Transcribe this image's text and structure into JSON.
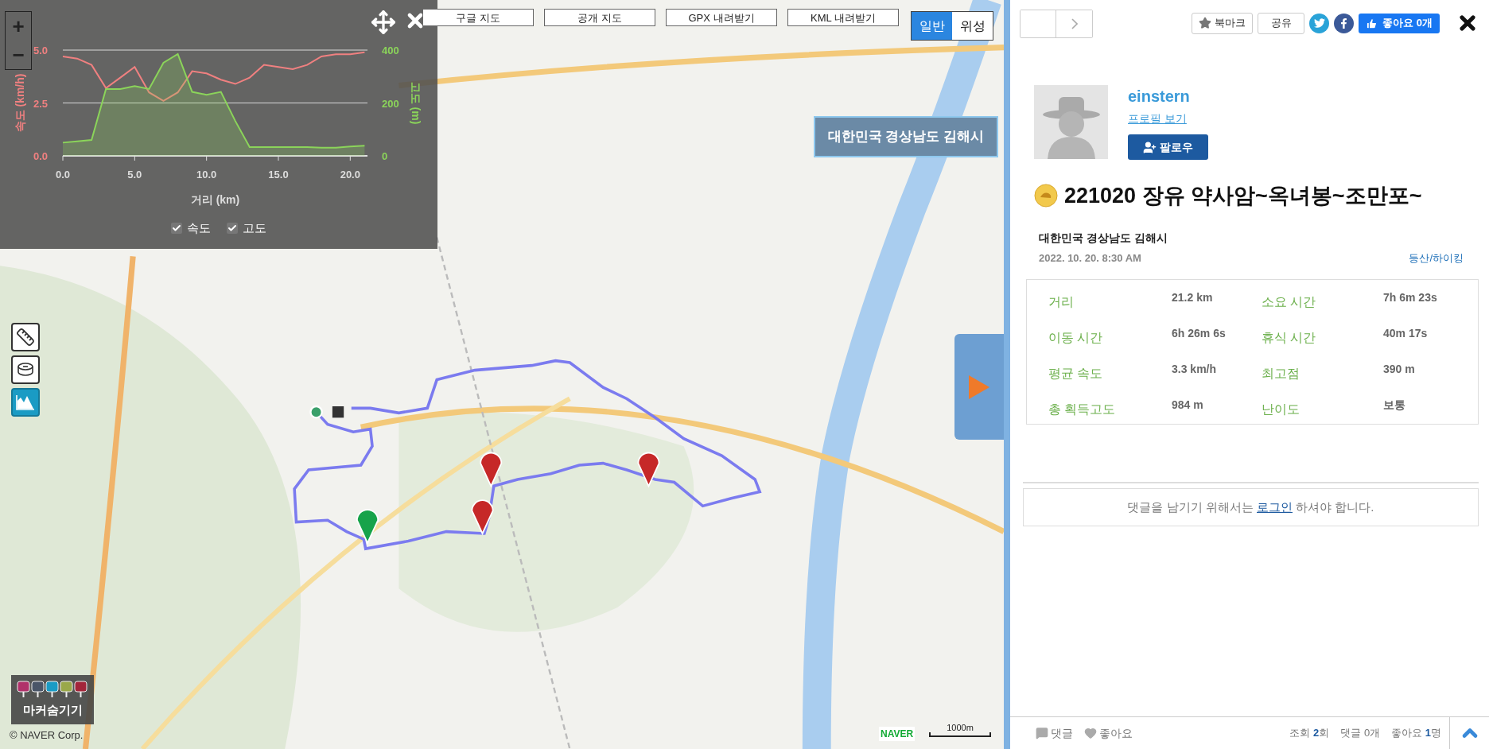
{
  "map": {
    "top_buttons": [
      "구글 지도",
      "공개 지도",
      "GPX 내려받기",
      "KML 내려받기"
    ],
    "map_types": [
      {
        "label": "일반",
        "selected": true
      },
      {
        "label": "위성",
        "selected": false
      }
    ],
    "location_label": "대한민국 경상남도 김해시",
    "tools": [
      {
        "kind": "ruler",
        "selected": false
      },
      {
        "kind": "tape",
        "selected": false
      },
      {
        "kind": "chart",
        "selected": true
      }
    ],
    "marker_toggle": "마커숨기기",
    "attribution": "© NAVER Corp.",
    "logo": "NAVER",
    "scale": "1000m"
  },
  "elevation_panel": {
    "zoom": [
      "+",
      "−"
    ],
    "chart_data": {
      "type": "line",
      "xlabel": "거리 (km)",
      "ylabel": "속도 (km/h)",
      "y2label": "고도 (m)",
      "x": [
        0,
        1,
        2,
        3,
        4,
        5,
        6,
        7,
        8,
        9,
        10,
        11,
        12,
        13,
        14,
        15,
        16,
        17,
        18,
        19,
        20,
        21
      ],
      "xlim": [
        0,
        21.2
      ],
      "ylim": [
        0,
        5
      ],
      "y2lim": [
        0,
        400
      ],
      "xticks": [
        {
          "value": 0,
          "label": "0.0"
        },
        {
          "value": 5,
          "label": "5.0"
        },
        {
          "value": 10,
          "label": "10.0"
        },
        {
          "value": 15,
          "label": "15.0"
        },
        {
          "value": 20,
          "label": "20.0"
        }
      ],
      "yticks": [
        {
          "value": 0,
          "label": "0.0"
        },
        {
          "value": 2.5,
          "label": "2.5"
        },
        {
          "value": 5,
          "label": "5.0"
        }
      ],
      "y2ticks": [
        0,
        200,
        400
      ],
      "series": [
        {
          "name": "속도",
          "color": "#f08080",
          "values": [
            4.7,
            4.6,
            4.3,
            3.2,
            3.7,
            4.2,
            3.0,
            2.6,
            3.0,
            4.0,
            3.9,
            3.6,
            3.4,
            3.7,
            4.3,
            4.2,
            4.1,
            4.3,
            4.7,
            4.8,
            4.8,
            4.9
          ]
        },
        {
          "name": "고도",
          "color": "#8bd45a",
          "axis": "y2",
          "type": "area",
          "values": [
            50,
            55,
            60,
            253,
            253,
            264,
            253,
            352,
            385,
            242,
            231,
            242,
            132,
            33,
            33,
            33,
            33,
            33,
            31,
            31,
            35,
            38
          ]
        }
      ]
    },
    "toggles": [
      {
        "checked": true
      },
      {
        "checked": true
      }
    ]
  },
  "detail": {
    "actions": [
      {
        "kind": "bookmark",
        "label": "북마크"
      },
      {
        "kind": "share",
        "label": "공유"
      },
      {
        "kind": "twitter"
      },
      {
        "kind": "facebook"
      },
      {
        "kind": "like",
        "label": "좋아요 0개"
      }
    ],
    "profile": {
      "username": "einstern",
      "profile_link": "프로필 보기",
      "follow": "팔로우"
    },
    "title": "221020 장유 약사암~옥녀봉~조만포~",
    "location": "대한민국 경상남도 김해시",
    "date": "2022. 10. 20. 8:30 AM",
    "category": "등산/하이킹",
    "stats": [
      {
        "label": "거리",
        "value": "21.2 km"
      },
      {
        "label": "소요 시간",
        "value": "7h 6m 23s"
      },
      {
        "label": "이동 시간",
        "value": "6h 26m 6s"
      },
      {
        "label": "휴식 시간",
        "value": "40m 17s"
      },
      {
        "label": "평균 속도",
        "value": "3.3 km/h"
      },
      {
        "label": "최고점",
        "value": "390 m"
      },
      {
        "label": "총 획득고도",
        "value": "984 m"
      },
      {
        "label": "난이도",
        "value": "보통"
      }
    ],
    "comment_notice": {
      "before": "댓글을 남기기 위해서는",
      "link": "로그인",
      "after": "하셔야 합니다."
    },
    "footer": {
      "actions": [
        {
          "kind": "comment",
          "label": "댓글"
        },
        {
          "kind": "like",
          "label": "좋아요"
        }
      ],
      "counts": [
        "조회 **2**회",
        "댓글 0개",
        "좋아요 **1**명"
      ]
    }
  }
}
